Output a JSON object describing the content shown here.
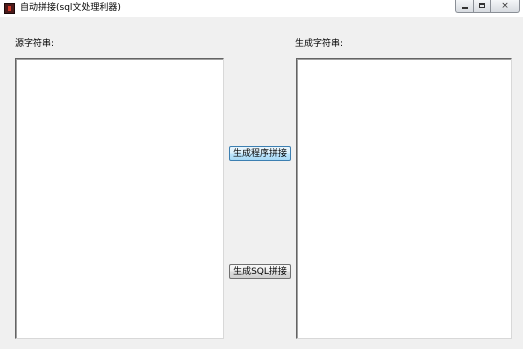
{
  "window": {
    "title": "自动拼接(sql文处理利器)",
    "controls": {
      "minimize": "minimize",
      "maximize": "maximize",
      "close": "×"
    }
  },
  "source": {
    "label": "源字符串:",
    "value": ""
  },
  "output": {
    "label": "生成字符串:",
    "value": ""
  },
  "buttons": {
    "generate_program": "生成程序拼接",
    "generate_sql": "生成SQL拼接"
  }
}
